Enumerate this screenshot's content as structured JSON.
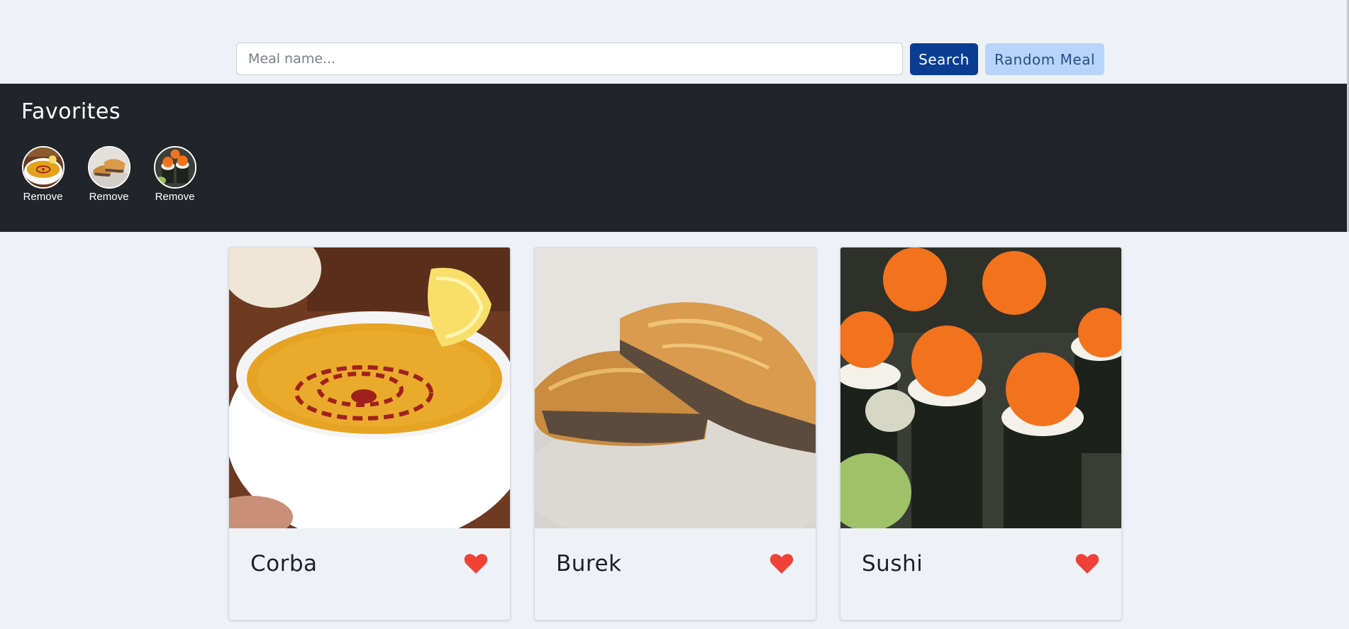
{
  "search": {
    "placeholder": "Meal name...",
    "value": "",
    "search_label": "Search",
    "random_label": "Random Meal"
  },
  "favorites": {
    "title": "Favorites",
    "items": [
      {
        "meal": "Corba",
        "remove_label": "Remove"
      },
      {
        "meal": "Burek",
        "remove_label": "Remove"
      },
      {
        "meal": "Sushi",
        "remove_label": "Remove"
      }
    ]
  },
  "meals": [
    {
      "name": "Corba",
      "favorited": true
    },
    {
      "name": "Burek",
      "favorited": true
    },
    {
      "name": "Sushi",
      "favorited": true
    }
  ],
  "colors": {
    "background": "#eef2f7",
    "favorites_bar": "#212529",
    "primary_button": "#0a3d91",
    "secondary_button": "#b9d4fb",
    "heart": "#ef4136"
  },
  "icons": {
    "favorite": "heart-icon"
  }
}
